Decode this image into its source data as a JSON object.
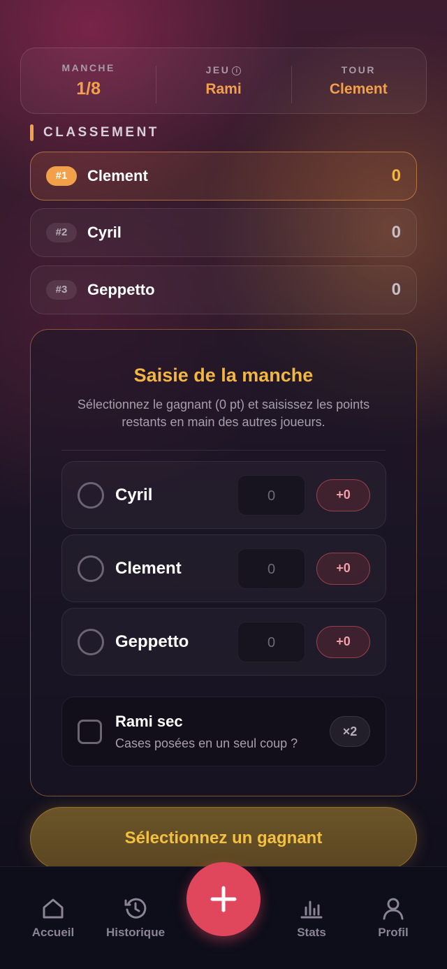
{
  "header": {
    "manche_label": "MANCHE",
    "manche_value": "1/8",
    "jeu_label": "JEU",
    "jeu_value": "Rami",
    "tour_label": "TOUR",
    "tour_value": "Clement"
  },
  "classement": {
    "title": "CLASSEMENT",
    "rows": [
      {
        "rank": "#1",
        "name": "Clement",
        "score": "0"
      },
      {
        "rank": "#2",
        "name": "Cyril",
        "score": "0"
      },
      {
        "rank": "#3",
        "name": "Geppetto",
        "score": "0"
      }
    ]
  },
  "entry": {
    "title": "Saisie de la manche",
    "subtitle": "Sélectionnez le gagnant (0 pt) et saisissez les points restants en main des autres joueurs.",
    "players": [
      {
        "name": "Cyril",
        "points": "0",
        "plus_label": "+0"
      },
      {
        "name": "Clement",
        "points": "0",
        "plus_label": "+0"
      },
      {
        "name": "Geppetto",
        "points": "0",
        "plus_label": "+0"
      }
    ],
    "rami_sec": {
      "title": "Rami sec",
      "subtitle": "Cases posées en un seul coup ?",
      "multiplier": "×2"
    }
  },
  "submit_button": "Sélectionnez un gagnant",
  "nav": {
    "items": [
      {
        "label": "Accueil",
        "icon": "home-icon"
      },
      {
        "label": "Historique",
        "icon": "history-icon"
      },
      {
        "label": "Stats",
        "icon": "stats-icon"
      },
      {
        "label": "Profil",
        "icon": "profile-icon"
      }
    ],
    "fab_icon": "plus-icon"
  },
  "colors": {
    "accent_orange": "#f3a04a",
    "accent_gold": "#f3b640",
    "fab_red": "#e0475d"
  }
}
